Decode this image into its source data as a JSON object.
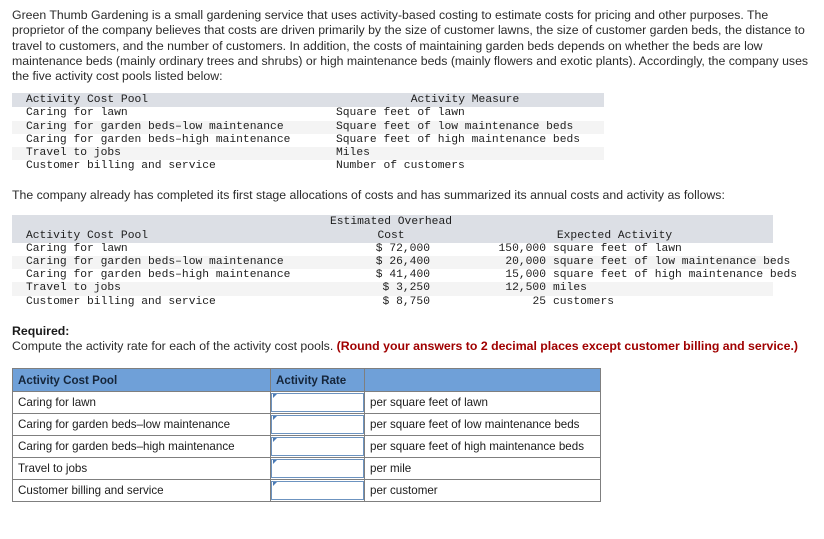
{
  "intro": {
    "paragraph": "Green Thumb Gardening is a small gardening service that uses activity-based costing to estimate costs for pricing and other purposes. The proprietor of the company believes that costs are driven primarily by the size of customer lawns, the size of customer garden beds, the distance to travel to customers, and the number of customers. In addition, the costs of maintaining garden beds depends on whether the beds are low maintenance beds (mainly ordinary trees and shrubs) or high maintenance beds (mainly flowers and exotic plants). Accordingly, the company uses the five activity cost pools listed below:",
    "second_paragraph": "The company already has completed its first stage allocations of costs and has summarized its annual costs and activity as follows:"
  },
  "table_pools": {
    "headers": {
      "pool": "Activity Cost Pool",
      "measure": "Activity Measure"
    },
    "rows": [
      {
        "pool": "Caring for lawn",
        "measure": "Square feet of lawn"
      },
      {
        "pool": "Caring for garden beds–low maintenance",
        "measure": "Square feet of low maintenance beds"
      },
      {
        "pool": "Caring for garden beds–high maintenance",
        "measure": "Square feet of high maintenance beds"
      },
      {
        "pool": "Travel to jobs",
        "measure": "Miles"
      },
      {
        "pool": "Customer billing and service",
        "measure": "Number of customers"
      }
    ]
  },
  "table_costs": {
    "headers": {
      "pool": "Activity Cost Pool",
      "cost_line1": "Estimated Overhead",
      "cost_line2": "Cost",
      "expected": "Expected Activity"
    },
    "rows": [
      {
        "pool": "Caring for lawn",
        "cost": "$ 72,000",
        "activity": "150,000",
        "unit": "square feet of lawn"
      },
      {
        "pool": "Caring for garden beds–low maintenance",
        "cost": "$ 26,400",
        "activity": "20,000",
        "unit": "square feet of low maintenance beds"
      },
      {
        "pool": "Caring for garden beds–high maintenance",
        "cost": "$ 41,400",
        "activity": "15,000",
        "unit": "square feet of high maintenance beds"
      },
      {
        "pool": "Travel to jobs",
        "cost": "$ 3,250",
        "activity": "12,500",
        "unit": "miles"
      },
      {
        "pool": "Customer billing and service",
        "cost": "$ 8,750",
        "activity": "25",
        "unit": "customers"
      }
    ]
  },
  "required": {
    "title": "Required:",
    "text": "Compute the activity rate for each of the activity cost pools.",
    "note": "(Round your answers to 2 decimal places except customer billing and service.)"
  },
  "answer_table": {
    "headers": {
      "pool": "Activity Cost Pool",
      "rate": "Activity Rate",
      "unit": ""
    },
    "rows": [
      {
        "pool": "Caring for lawn",
        "rate_value": "",
        "unit": "per square feet of lawn"
      },
      {
        "pool": "Caring for garden beds–low maintenance",
        "rate_value": "",
        "unit": "per square feet of low maintenance beds"
      },
      {
        "pool": "Caring for garden beds–high maintenance",
        "rate_value": "",
        "unit": "per square feet of high maintenance beds"
      },
      {
        "pool": "Travel to jobs",
        "rate_value": "",
        "unit": "per mile"
      },
      {
        "pool": "Customer billing and service",
        "rate_value": "",
        "unit": "per customer"
      }
    ]
  },
  "colors": {
    "header_blue": "#6fa0d8",
    "mono_header_gray": "#dcdfe5",
    "stripe_gray": "#f4f4f4",
    "note_red": "#a00000",
    "input_border": "#6c93c0"
  }
}
